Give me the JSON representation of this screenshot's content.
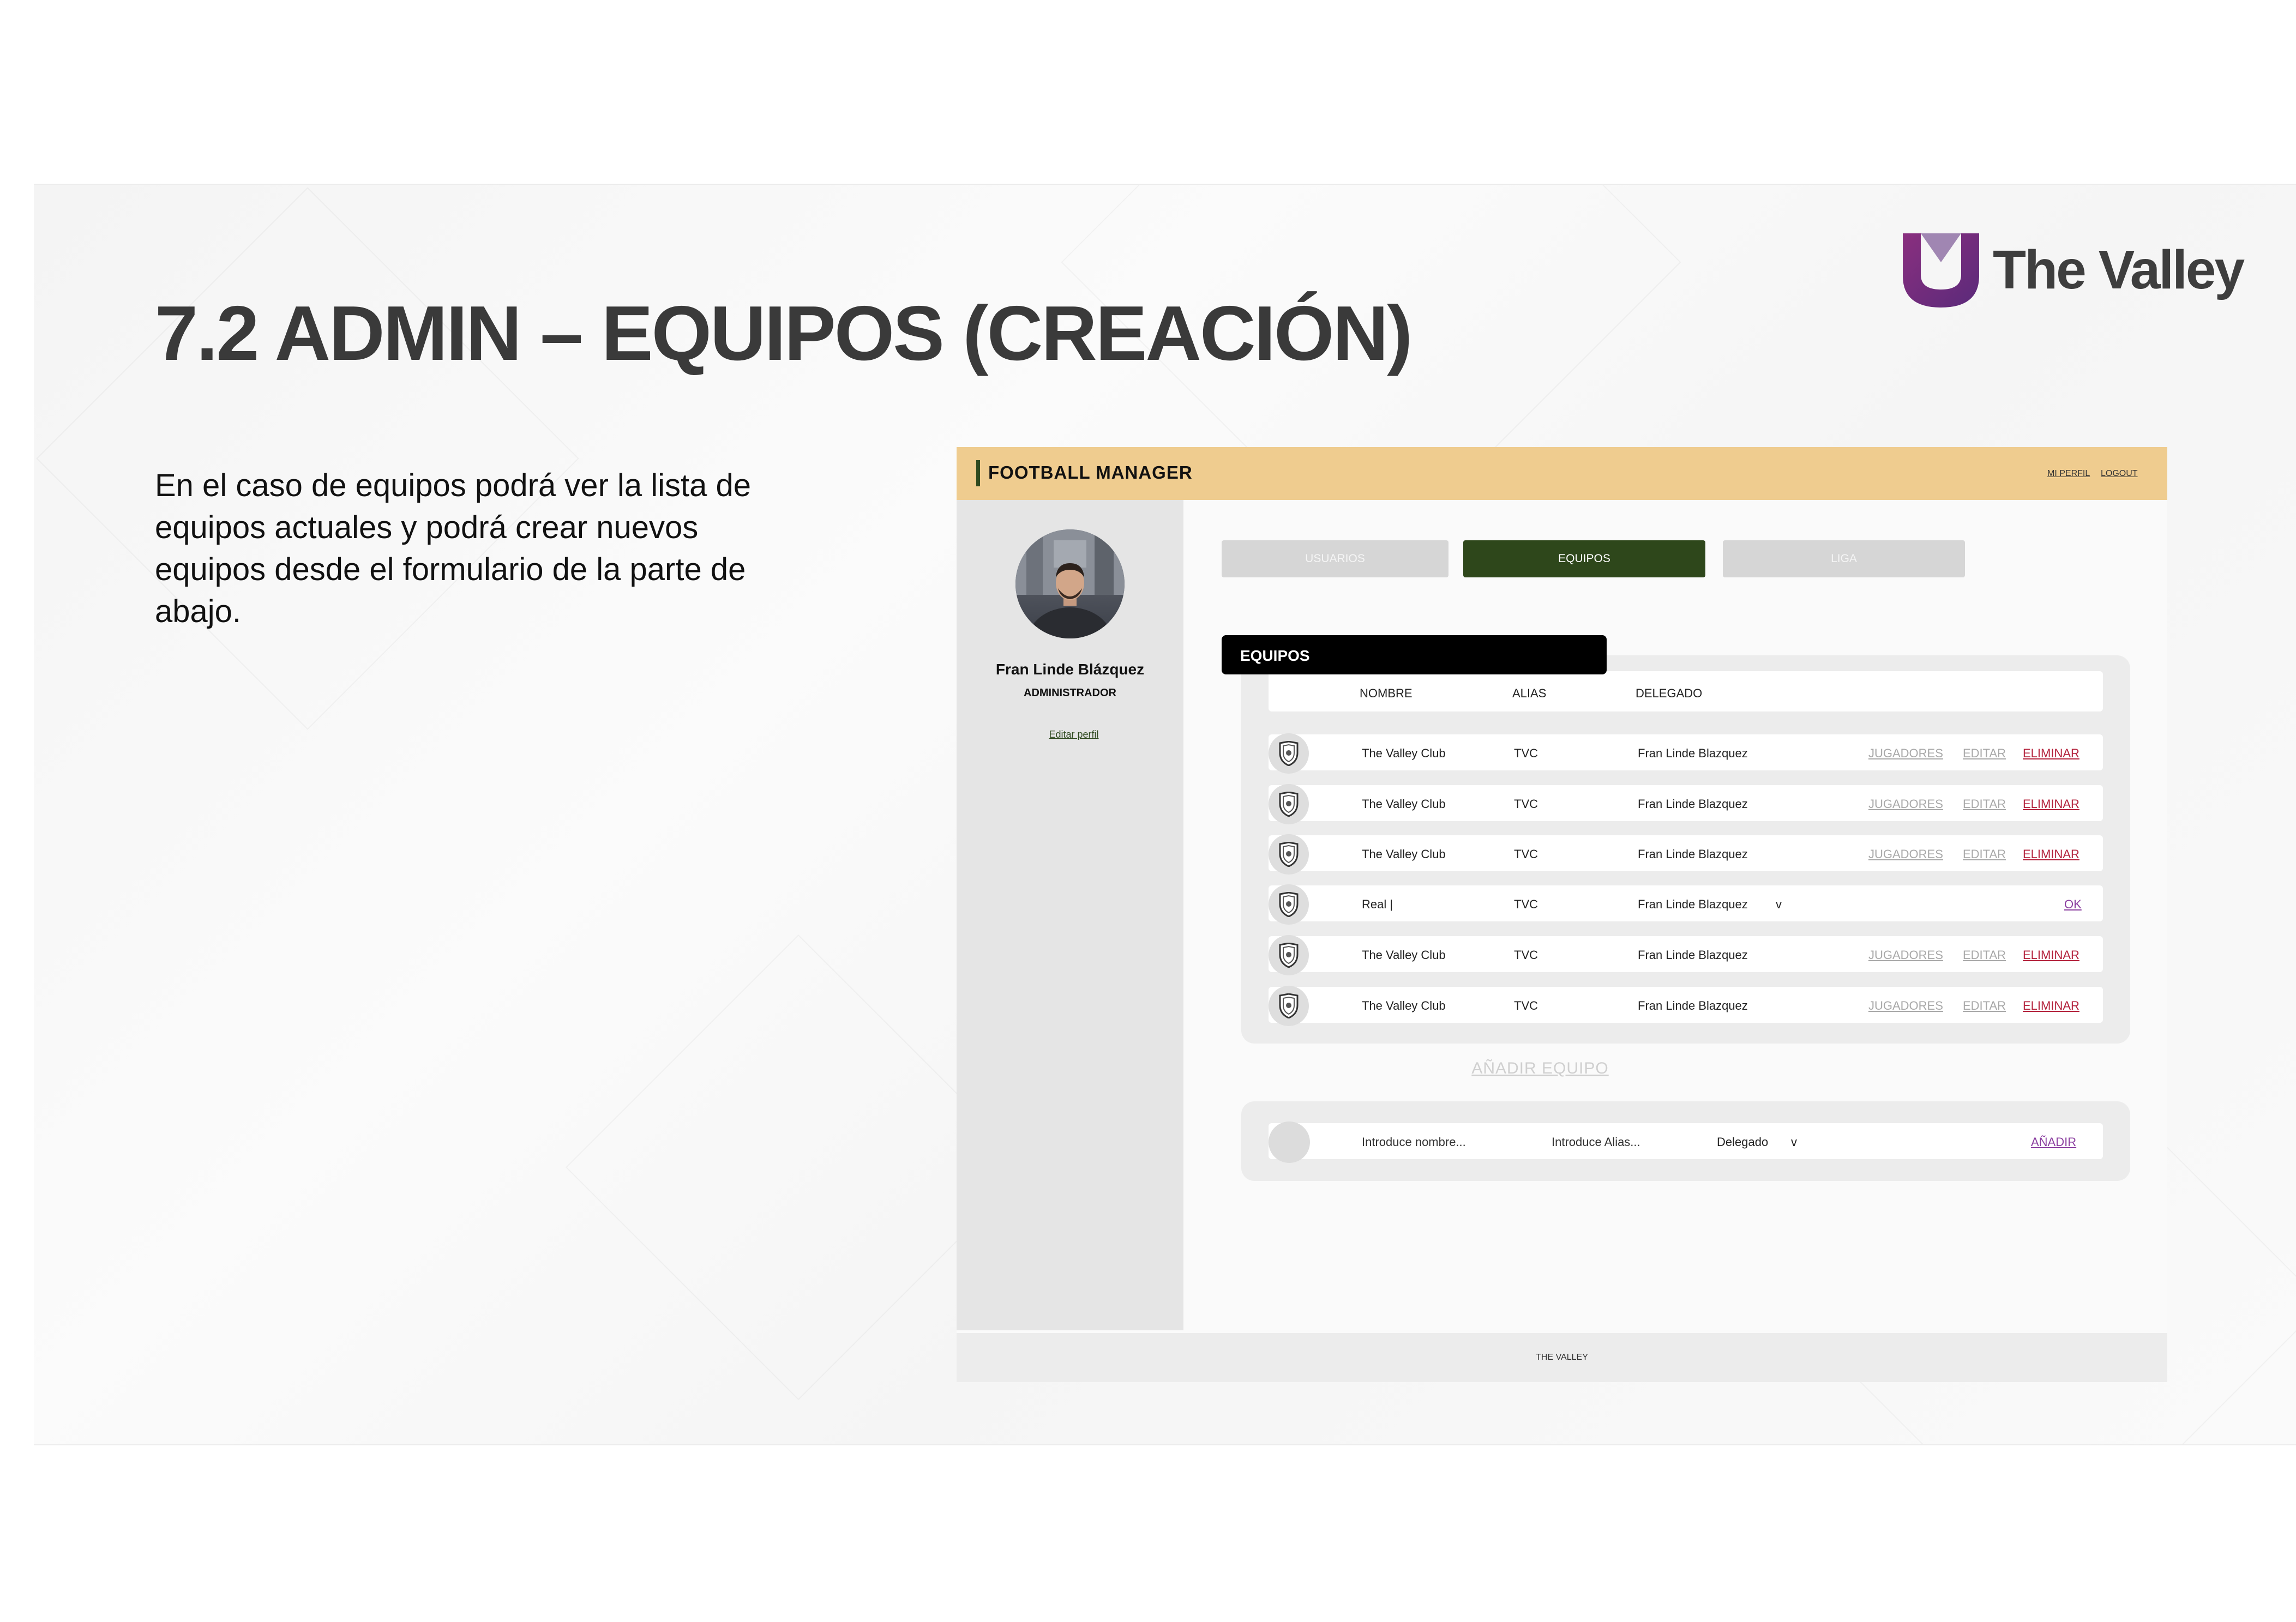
{
  "slide": {
    "title": "7.2 ADMIN – EQUIPOS (CREACIÓN)",
    "description": "En el caso de equipos podrá ver la lista de equipos actuales y podrá crear nuevos equipos desde el formulario de la parte de abajo.",
    "logo_text": "The Valley",
    "logo_color": "#7b2d86"
  },
  "app": {
    "brand": "FOOTBALL MANAGER",
    "header_links": {
      "profile": "MI PERFIL",
      "logout": "LOGOUT"
    },
    "colors": {
      "header": "#efcc8f",
      "active_tab": "#2e471b",
      "delete": "#b3213b",
      "ok": "#8b3fa0"
    },
    "user": {
      "name": "Fran Linde Blázquez",
      "role": "ADMINISTRADOR",
      "edit_link": "Editar perfil"
    },
    "tabs": [
      {
        "label": "USUARIOS",
        "active": false
      },
      {
        "label": "EQUIPOS",
        "active": true
      },
      {
        "label": "LIGA",
        "active": false
      }
    ],
    "section_title": "EQUIPOS",
    "columns": {
      "name": "NOMBRE",
      "alias": "ALIAS",
      "delegate": "DELEGADO"
    },
    "rows": [
      {
        "name": "The Valley Club",
        "alias": "TVC",
        "delegate": "Fran Linde Blazquez",
        "players": "JUGADORES",
        "edit": "EDITAR",
        "delete": "ELIMINAR"
      },
      {
        "name": "The Valley Club",
        "alias": "TVC",
        "delegate": "Fran Linde Blazquez",
        "players": "JUGADORES",
        "edit": "EDITAR",
        "delete": "ELIMINAR"
      },
      {
        "name": "The Valley Club",
        "alias": "TVC",
        "delegate": "Fran Linde Blazquez",
        "players": "JUGADORES",
        "edit": "EDITAR",
        "delete": "ELIMINAR"
      },
      {
        "name": "Real |",
        "alias": "TVC",
        "delegate": "Fran Linde Blazquez",
        "dropdown": "v",
        "ok": "OK",
        "editing": true
      },
      {
        "name": "The Valley Club",
        "alias": "TVC",
        "delegate": "Fran Linde Blazquez",
        "players": "JUGADORES",
        "edit": "EDITAR",
        "delete": "ELIMINAR"
      },
      {
        "name": "The Valley Club",
        "alias": "TVC",
        "delegate": "Fran Linde Blazquez",
        "players": "JUGADORES",
        "edit": "EDITAR",
        "delete": "ELIMINAR"
      }
    ],
    "add_title": "AÑADIR EQUIPO",
    "form": {
      "name_placeholder": "Introduce nombre...",
      "alias_placeholder": "Introduce Alias...",
      "delegate_label": "Delegado",
      "dropdown": "v",
      "submit": "AÑADIR"
    },
    "footer": "THE VALLEY"
  }
}
